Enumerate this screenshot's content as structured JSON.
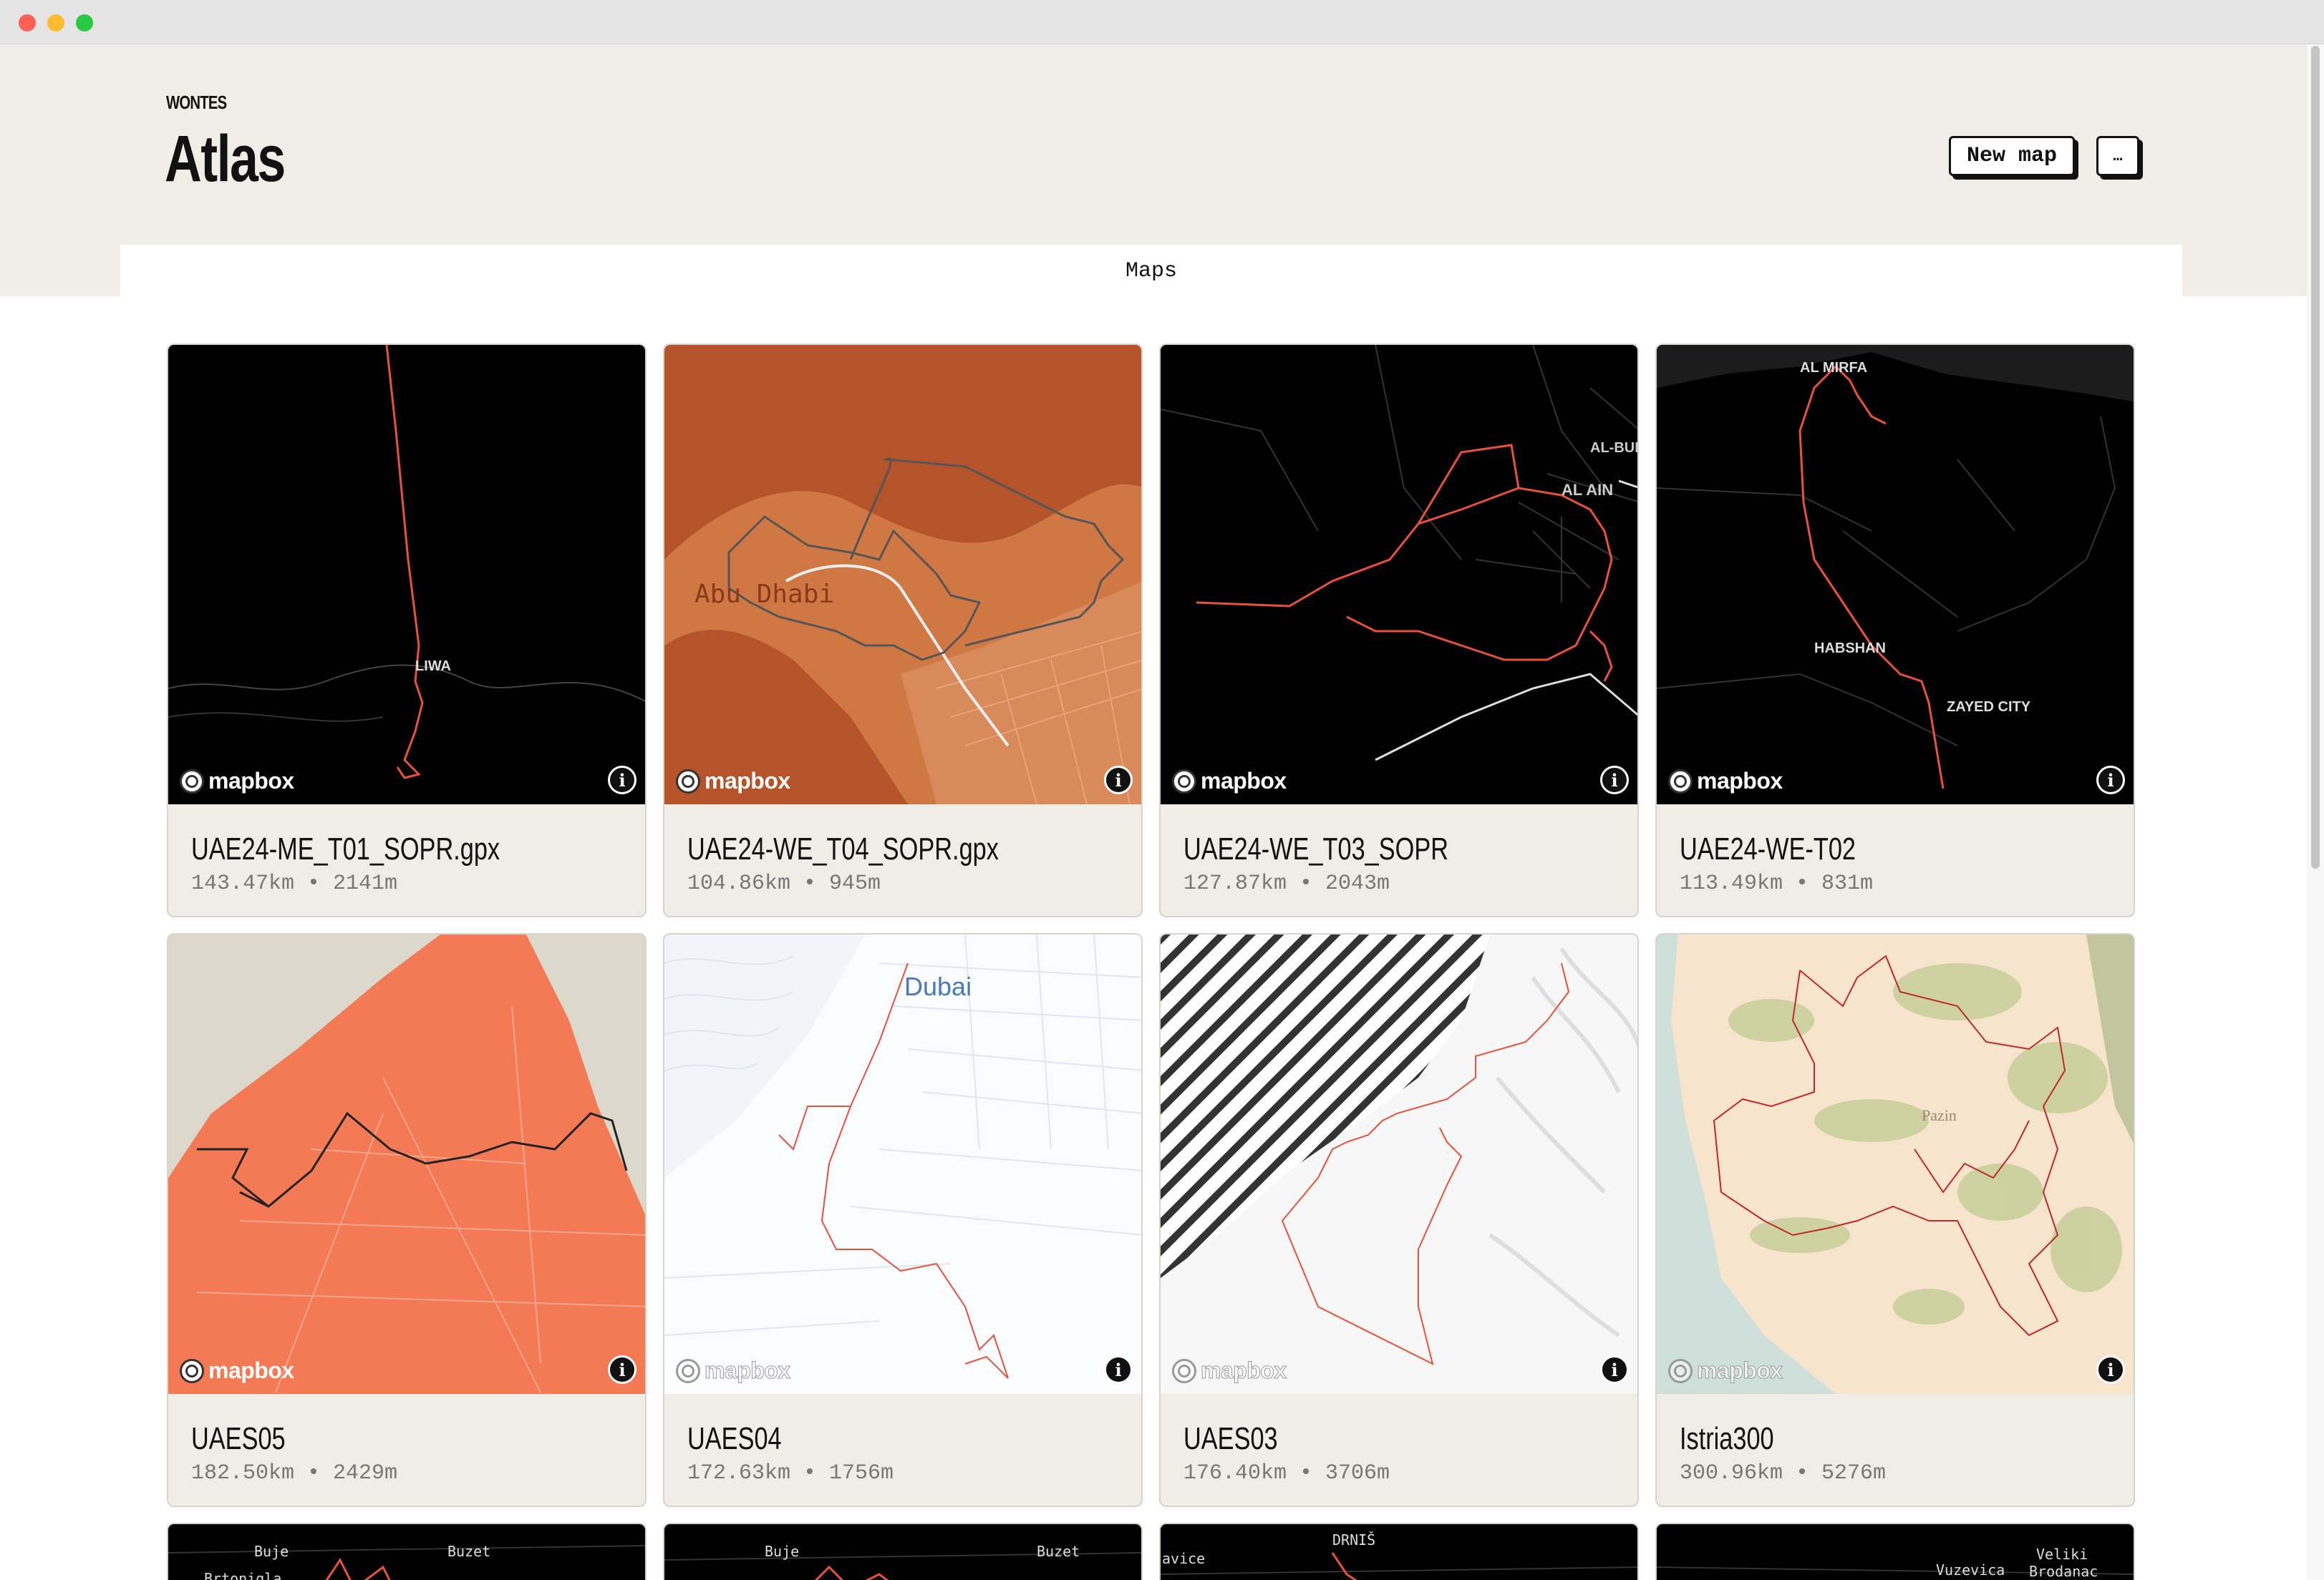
{
  "app": {
    "logo": "WONTES",
    "title": "Atlas"
  },
  "toolbar": {
    "new_map_label": "New map",
    "more_label": "…"
  },
  "tabs": [
    {
      "label": "Maps",
      "active": true
    }
  ],
  "cards": [
    {
      "title": "UAE24-ME_T01_SOPR.gpx",
      "meta": "143.47km • 2141m",
      "map_style": "dark",
      "map_labels": [
        "LIWA"
      ],
      "attribution": "mapbox",
      "info_icon": "info-icon"
    },
    {
      "title": "UAE24-WE_T04_SOPR.gpx",
      "meta": "104.86km • 945m",
      "map_style": "terracotta",
      "map_labels": [
        "Abu Dhabi"
      ],
      "attribution": "mapbox",
      "info_icon": "info-icon"
    },
    {
      "title": "UAE24-WE_T03_SOPR",
      "meta": "127.87km • 2043m",
      "map_style": "dark",
      "map_labels": [
        "AL-BURA",
        "AL AIN"
      ],
      "attribution": "mapbox",
      "info_icon": "info-icon"
    },
    {
      "title": "UAE24-WE-T02",
      "meta": "113.49km • 831m",
      "map_style": "dark",
      "map_labels": [
        "AL MIRFA",
        "HABSHAN",
        "ZAYED CITY"
      ],
      "attribution": "mapbox",
      "info_icon": "info-icon"
    },
    {
      "title": "UAES05",
      "meta": "182.50km • 2429m",
      "map_style": "coral",
      "map_labels": [],
      "attribution": "mapbox",
      "info_icon": "info-icon"
    },
    {
      "title": "UAES04",
      "meta": "172.63km • 1756m",
      "map_style": "light-blue",
      "map_labels": [
        "Dubai"
      ],
      "attribution": "mapbox",
      "info_icon": "info-icon"
    },
    {
      "title": "UAES03",
      "meta": "176.40km • 3706m",
      "map_style": "hatched",
      "map_labels": [],
      "attribution": "mapbox",
      "info_icon": "info-icon"
    },
    {
      "title": "Istria300",
      "meta": "300.96km • 5276m",
      "map_style": "terrain",
      "map_labels": [
        "Pazin"
      ],
      "attribution": "mapbox",
      "info_icon": "info-icon"
    }
  ],
  "peek_cards": [
    {
      "map_labels": [
        "Buje",
        "Buzet",
        "Brtonigla"
      ]
    },
    {
      "map_labels": [
        "Buje",
        "Buzet"
      ]
    },
    {
      "map_labels": [
        "DRNIŠ",
        "avice"
      ]
    },
    {
      "map_labels": [
        "Veliki",
        "Vuzevica",
        "Brodanac"
      ]
    }
  ],
  "colors": {
    "header_bg": "#efede5",
    "route_red": "#e8513a",
    "terracotta": "#b5542a",
    "coral": "#f47a55"
  }
}
